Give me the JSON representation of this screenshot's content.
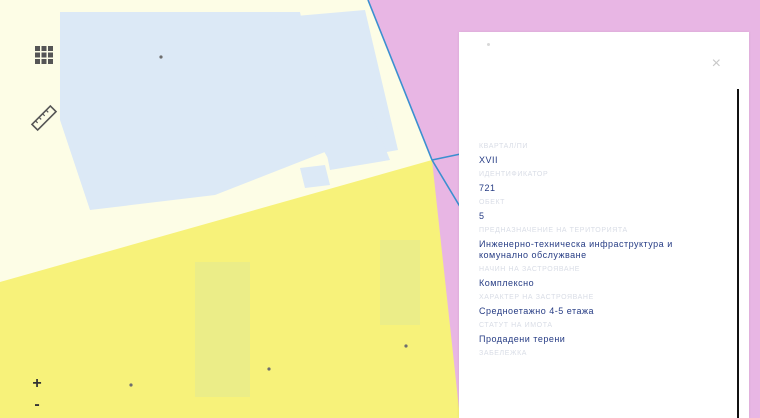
{
  "map": {
    "colors": {
      "background": "#fdfde6",
      "yellow_zone": "#f7f27a",
      "purple_zone": "#e8b6e4",
      "light_blue": "#dce9f6",
      "boundary": "#3b8fd0"
    }
  },
  "tools": {
    "grid_icon": "grid-icon",
    "ruler_icon": "ruler-icon"
  },
  "zoom": {
    "in_label": "+",
    "out_label": "-"
  },
  "panel": {
    "close_label": "×",
    "fields": [
      {
        "label": "КВАРТАЛ/ПИ",
        "value": "XVII"
      },
      {
        "label": "ИДЕНТИФИКАТОР",
        "value": "721"
      },
      {
        "label": "ОБЕКТ",
        "value": "5"
      },
      {
        "label": "ПРЕДНАЗНАЧЕНИЕ НА ТЕРИТОРИЯТА",
        "value": "Инженерно-техническа инфраструктура и комунално обслужване"
      },
      {
        "label": "НАЧИН НА ЗАСТРОЯВАНЕ",
        "value": "Комплексно"
      },
      {
        "label": "ХАРАКТЕР НА ЗАСТРОЯВАНЕ",
        "value": "Средноетажно 4-5 етажа"
      },
      {
        "label": "СТАТУТ НА ИМОТА",
        "value": "Продадени терени"
      },
      {
        "label": "ЗАБЕЛЕЖКА",
        "value": ""
      }
    ]
  }
}
